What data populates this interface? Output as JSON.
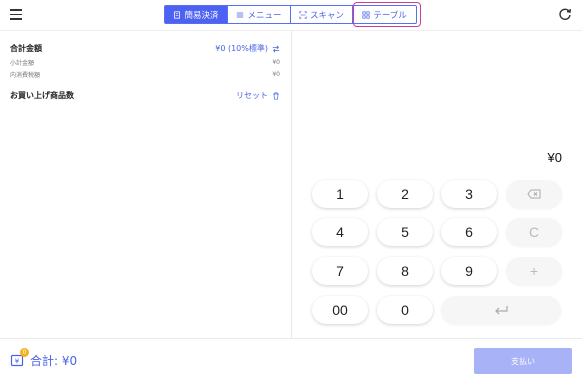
{
  "header": {
    "tabs": [
      {
        "label": "簡易決済",
        "icon": "receipt-icon",
        "active": true
      },
      {
        "label": "メニュー",
        "icon": "list-icon",
        "active": false
      },
      {
        "label": "スキャン",
        "icon": "scan-icon",
        "active": false
      },
      {
        "label": "テーブル",
        "icon": "grid-icon",
        "active": false
      }
    ]
  },
  "summary": {
    "total_label": "合計金額",
    "total_value": "¥0 (10%標準)",
    "subtotal_label": "小計金額",
    "subtotal_value": "¥0",
    "tax_label": "内消費税額",
    "tax_value": "¥0",
    "items_label": "お買い上げ商品数",
    "reset_label": "リセット"
  },
  "keypad": {
    "display": "¥0",
    "keys": [
      "1",
      "2",
      "3",
      "4",
      "5",
      "6",
      "C",
      "7",
      "8",
      "9",
      "+",
      "00",
      "0"
    ]
  },
  "footer": {
    "badge": "0",
    "total": "合計: ¥0",
    "pay_label": "支払い"
  },
  "colors": {
    "accent": "#4d61f2",
    "highlight_border": "#d4389a",
    "pay_disabled": "#a8b2f6",
    "badge": "#f2b21b"
  }
}
